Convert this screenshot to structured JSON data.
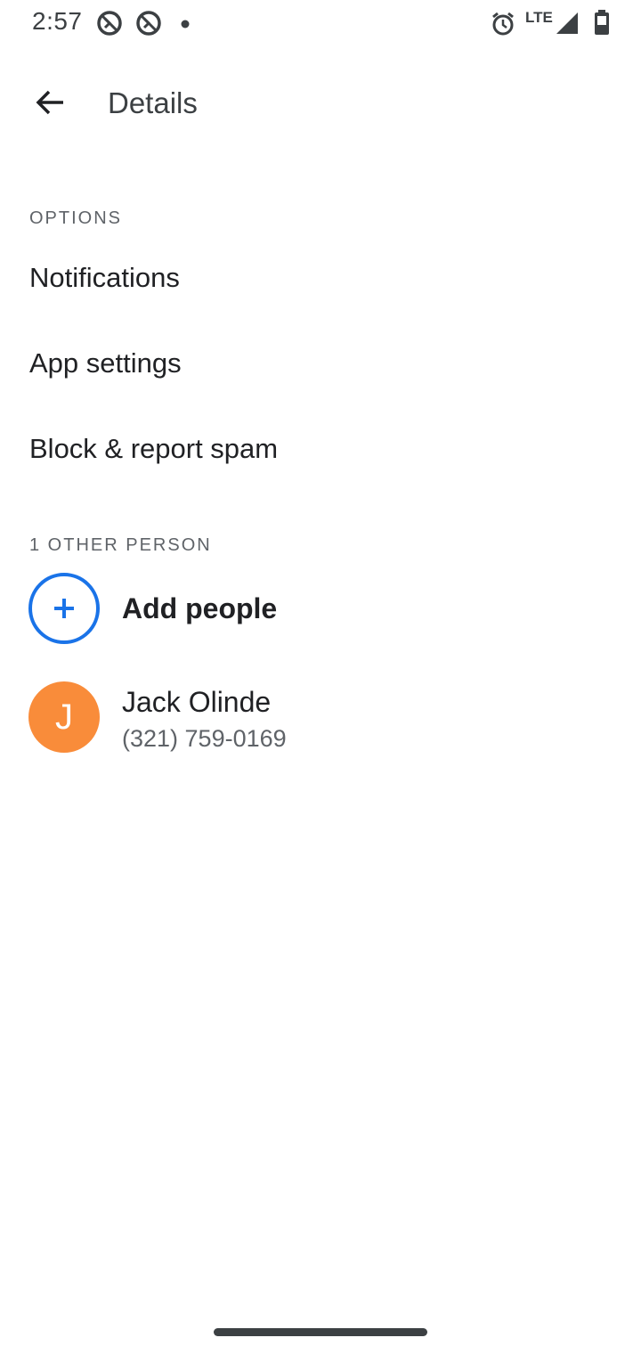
{
  "status_bar": {
    "time": "2:57",
    "network": "LTE",
    "icons": [
      "sync-disabled-icon",
      "sync-disabled-icon",
      "dot-icon",
      "alarm-icon",
      "signal-icon",
      "battery-icon"
    ]
  },
  "app_bar": {
    "back_icon": "arrow-back-icon",
    "title": "Details"
  },
  "options": {
    "header": "OPTIONS",
    "items": [
      {
        "label": "Notifications"
      },
      {
        "label": "App settings"
      },
      {
        "label": "Block & report spam"
      }
    ]
  },
  "people": {
    "header": "1 OTHER PERSON",
    "add_label": "Add people",
    "add_icon": "add-icon",
    "contacts": [
      {
        "initial": "J",
        "name": "Jack Olinde",
        "phone": "(321) 759-0169",
        "avatar_color": "#f98c3a"
      }
    ]
  },
  "colors": {
    "accent": "#1a73e8",
    "text_primary": "#202124",
    "text_secondary": "#5f6368"
  }
}
